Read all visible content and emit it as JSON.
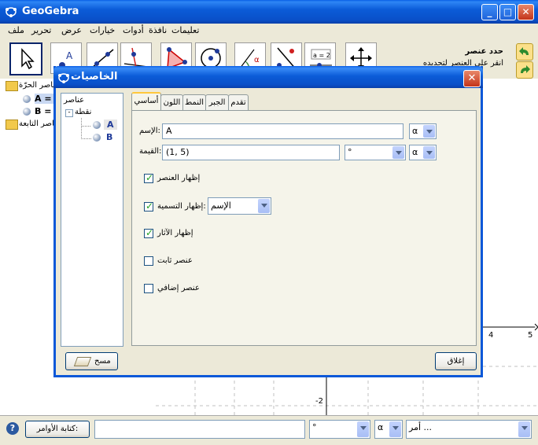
{
  "window": {
    "title": "GeoGebra"
  },
  "menu": [
    "ملف",
    "تحرير",
    "عرض",
    "خيارات",
    "أدوات",
    "نافذة",
    "تعليمات"
  ],
  "toolbar": {
    "tool_label": "حدد عنصر",
    "tool_hint": "أنقر على العنصر لتحديده",
    "slider_text": "a = 2"
  },
  "algebra": {
    "free_objects": "عناصر الحرّة",
    "point_a": "A = (",
    "point_b": "B = (",
    "dependent_objects": "عناصر التابعة"
  },
  "graphics": {
    "tick_4": "4",
    "tick_5": "5",
    "tick_neg2": "-2"
  },
  "dialog": {
    "title": "الخاصيات",
    "tree": {
      "root": "عناصر",
      "group": "نقطة",
      "items": [
        "A",
        "B"
      ]
    },
    "tabs": [
      "أساسي",
      "اللون",
      "النمط",
      "الجبر",
      "تقدم"
    ],
    "name_label": "الإسم:",
    "name_value": "A",
    "value_label": "القيمة:",
    "value_value": "(1, 5)",
    "degree_symbol": "°",
    "alpha_symbol": "α",
    "show_object": "إظهار العنصر",
    "show_label": "إظهار التسمية:",
    "label_mode": "الإسم",
    "show_trace": "إظهار الآثار",
    "fix_object": "عنصر ثابت",
    "aux_object": "عنصر إضافي",
    "checks": {
      "show_object": true,
      "show_label": true,
      "show_trace": true,
      "fix_object": false,
      "aux_object": false
    },
    "delete_button": "مسح",
    "close_button": "إغلاق"
  },
  "input": {
    "help": "?",
    "command_button": "كتابة الأوامر:",
    "degree": "°",
    "alpha": "α",
    "command_combo": "أمر ..."
  }
}
